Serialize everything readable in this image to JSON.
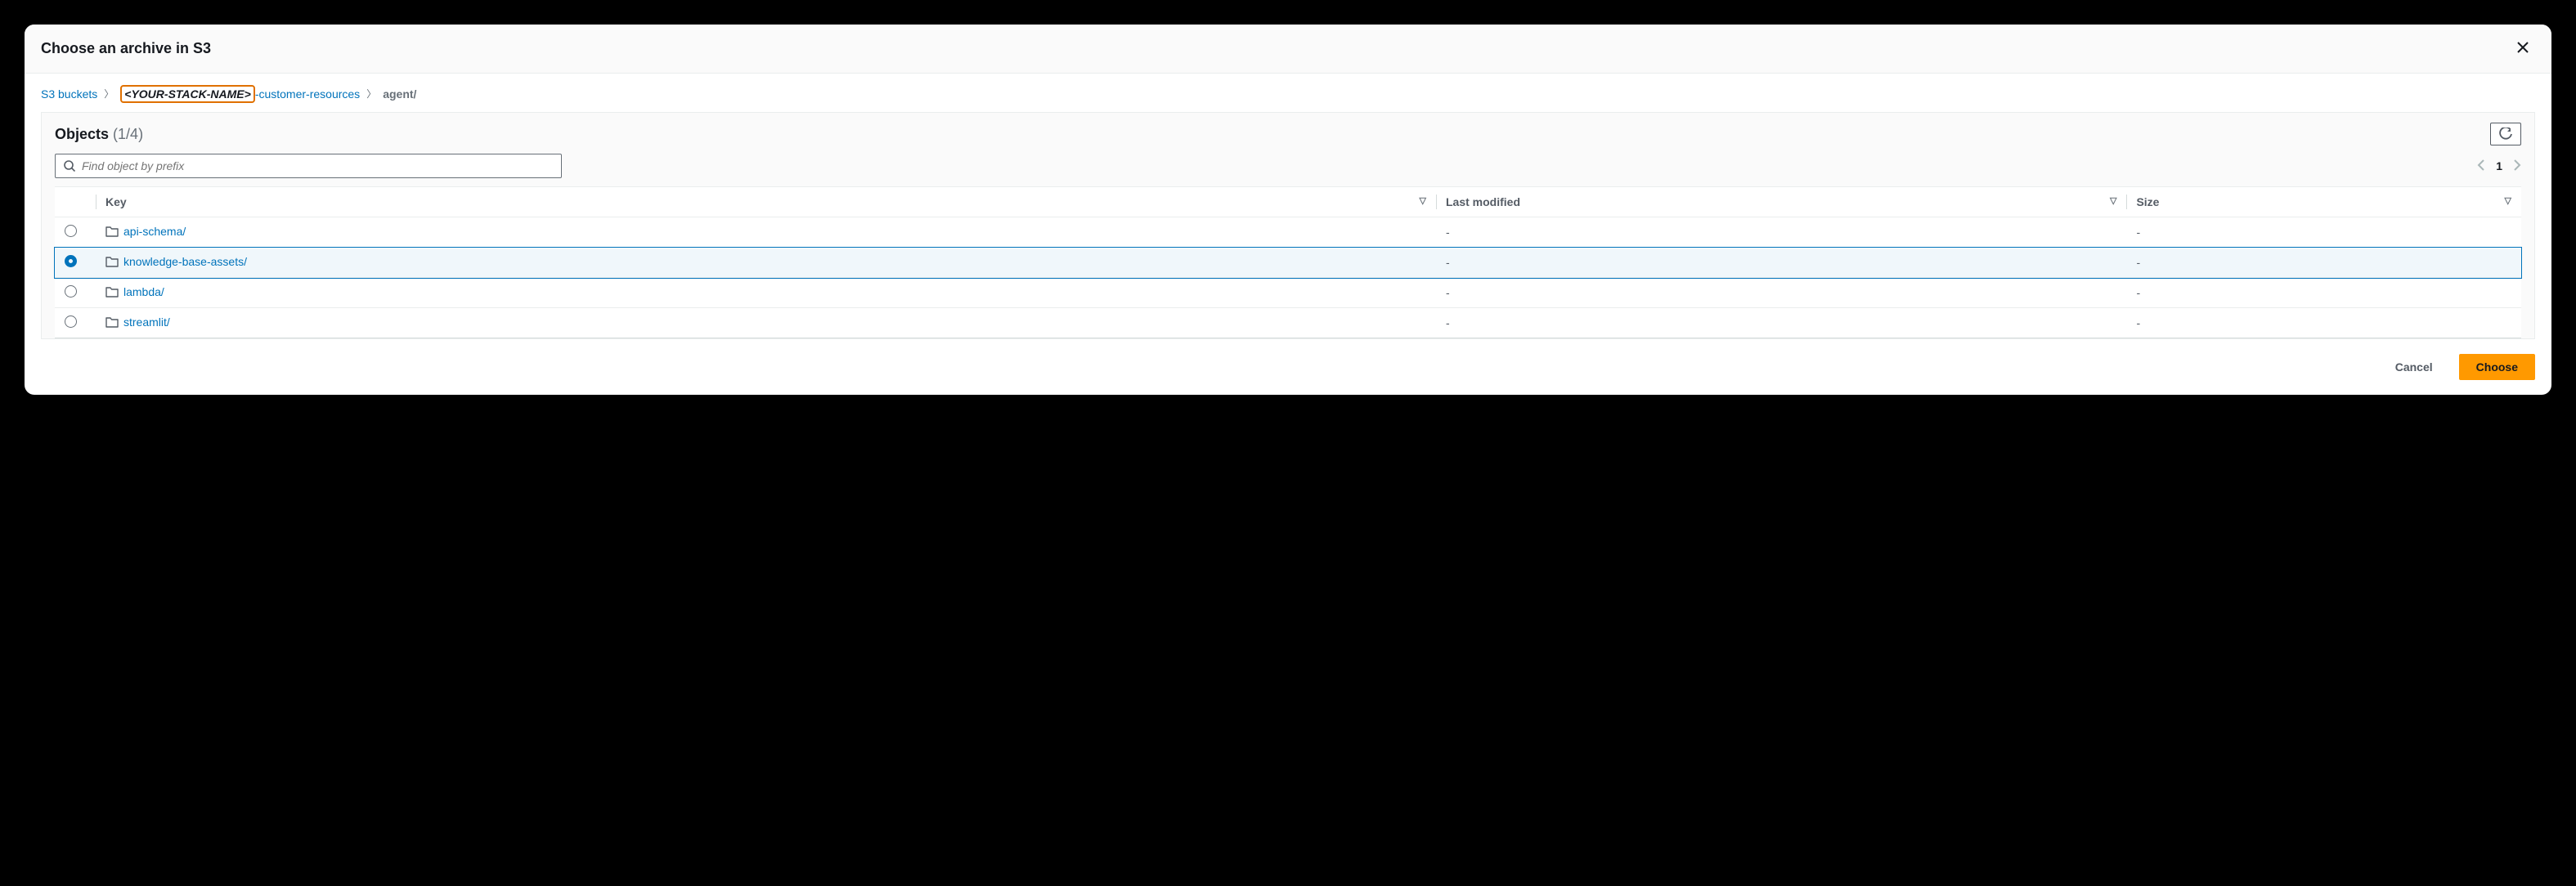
{
  "modal": {
    "title": "Choose an archive in S3"
  },
  "breadcrumb": {
    "root": "S3 buckets",
    "bucket_prefix_highlight": "<YOUR-STACK-NAME>",
    "bucket_suffix": "-customer-resources",
    "current": "agent/"
  },
  "panel": {
    "title": "Objects",
    "count": "(1/4)"
  },
  "search": {
    "placeholder": "Find object by prefix"
  },
  "pager": {
    "page": "1"
  },
  "columns": {
    "key": "Key",
    "last_modified": "Last modified",
    "size": "Size"
  },
  "rows": [
    {
      "name": "api-schema/",
      "last_modified": "-",
      "size": "-",
      "selected": false
    },
    {
      "name": "knowledge-base-assets/",
      "last_modified": "-",
      "size": "-",
      "selected": true
    },
    {
      "name": "lambda/",
      "last_modified": "-",
      "size": "-",
      "selected": false
    },
    {
      "name": "streamlit/",
      "last_modified": "-",
      "size": "-",
      "selected": false
    }
  ],
  "footer": {
    "cancel": "Cancel",
    "choose": "Choose"
  }
}
